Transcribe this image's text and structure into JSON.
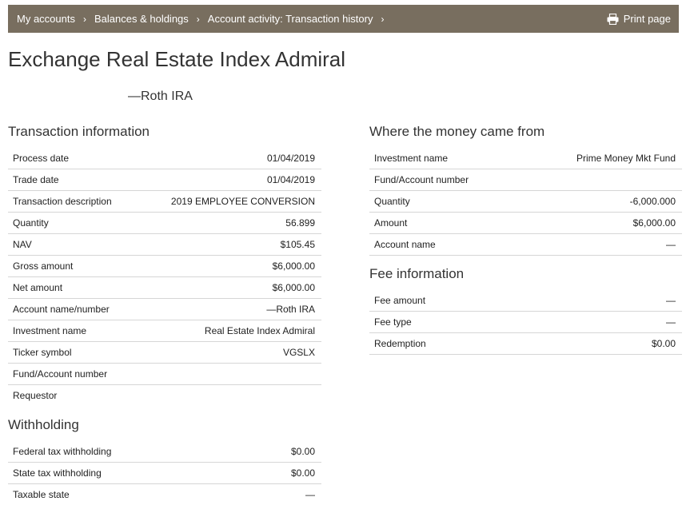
{
  "breadcrumb": {
    "items": [
      "My accounts",
      "Balances & holdings",
      "Account activity: Transaction history"
    ],
    "print_label": "Print page"
  },
  "page": {
    "title": "Exchange Real Estate Index Admiral",
    "subtitle": "—Roth IRA"
  },
  "transaction_info": {
    "heading": "Transaction information",
    "rows": [
      {
        "label": "Process date",
        "value": "01/04/2019"
      },
      {
        "label": "Trade date",
        "value": "01/04/2019"
      },
      {
        "label": "Transaction description",
        "value": "2019 EMPLOYEE CONVERSION"
      },
      {
        "label": "Quantity",
        "value": "56.899"
      },
      {
        "label": "NAV",
        "value": "$105.45"
      },
      {
        "label": "Gross amount",
        "value": "$6,000.00"
      },
      {
        "label": "Net amount",
        "value": "$6,000.00"
      },
      {
        "label": "Account name/number",
        "value": "—Roth IRA"
      },
      {
        "label": "Investment name",
        "value": "Real Estate Index Admiral"
      },
      {
        "label": "Ticker symbol",
        "value": "VGSLX"
      },
      {
        "label": "Fund/Account number",
        "value": ""
      },
      {
        "label": "Requestor",
        "value": ""
      }
    ]
  },
  "withholding": {
    "heading": "Withholding",
    "rows": [
      {
        "label": "Federal tax withholding",
        "value": "$0.00"
      },
      {
        "label": "State tax withholding",
        "value": "$0.00"
      },
      {
        "label": "Taxable state",
        "value": "—"
      }
    ]
  },
  "money_source": {
    "heading": "Where the money came from",
    "rows": [
      {
        "label": "Investment name",
        "value": "Prime Money Mkt Fund"
      },
      {
        "label": "Fund/Account number",
        "value": ""
      },
      {
        "label": "Quantity",
        "value": "-6,000.000"
      },
      {
        "label": "Amount",
        "value": "$6,000.00"
      },
      {
        "label": "Account name",
        "value": "—"
      }
    ]
  },
  "fee_info": {
    "heading": "Fee information",
    "rows": [
      {
        "label": "Fee amount",
        "value": "—"
      },
      {
        "label": "Fee type",
        "value": "—"
      },
      {
        "label": "Redemption",
        "value": "$0.00"
      }
    ]
  }
}
